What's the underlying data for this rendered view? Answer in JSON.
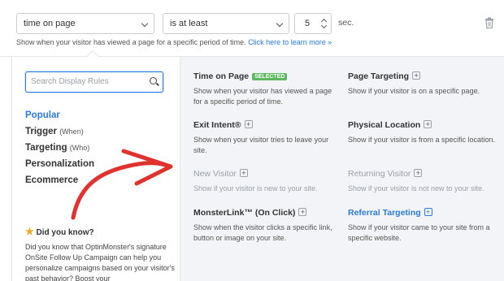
{
  "trigger": {
    "condition_select": "time on page",
    "operator_select": "is at least",
    "seconds_value": "5",
    "unit": "sec.",
    "helper_text": "Show when your visitor has viewed a page for a specific period of time.",
    "helper_link": "Click here to learn more »"
  },
  "sidebar": {
    "search_placeholder": "Search Display Rules",
    "categories": [
      {
        "label": "Popular",
        "suffix": ""
      },
      {
        "label": "Trigger",
        "suffix": "(When)"
      },
      {
        "label": "Targeting",
        "suffix": "(Who)"
      },
      {
        "label": "Personalization",
        "suffix": ""
      },
      {
        "label": "Ecommerce",
        "suffix": ""
      }
    ],
    "did_you_know_title": "Did you know?",
    "did_you_know_text": "Did you know that OptinMonster's signature OnSite Follow Up Campaign can help you personalize campaigns based on your visitor's past behavior? Boost your"
  },
  "rules": [
    {
      "title": "Time on Page",
      "badge": "SELECTED",
      "desc": "Show when your visitor has viewed a page for a specific period of time."
    },
    {
      "title": "Page Targeting",
      "desc": "Show if your visitor is on a specific page."
    },
    {
      "title": "Exit Intent®",
      "desc": "Show when your visitor tries to leave your site."
    },
    {
      "title": "Physical Location",
      "desc": "Show if your visitor is from a specific location."
    },
    {
      "title": "New Visitor",
      "desc": "Show if your visitor is new to your site."
    },
    {
      "title": "Returning Visitor",
      "desc": "Show if your visitor is not new to your site."
    },
    {
      "title": "MonsterLink™ (On Click)",
      "desc": "Show when the visitor clicks a specific link, button or image on your site."
    },
    {
      "title": "Referral Targeting",
      "desc": "Show if your visitor came to your site from a specific website."
    }
  ],
  "icons": {
    "delete": "trash-icon",
    "search": "search-icon",
    "star": "star-icon",
    "add": "plus-icon"
  },
  "colors": {
    "accent": "#2a7ae4",
    "selected_badge": "#5bb85d",
    "annotation_arrow": "#e0322f"
  }
}
